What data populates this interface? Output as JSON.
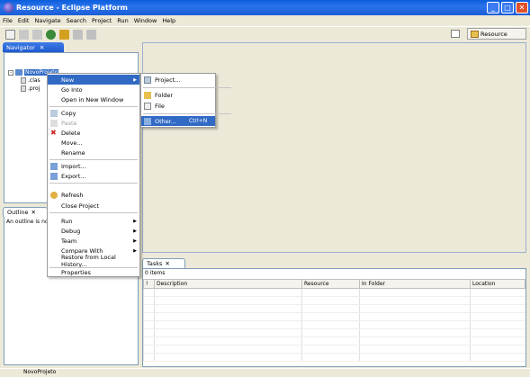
{
  "window": {
    "title": "Resource - Eclipse Platform"
  },
  "menubar": [
    "File",
    "Edit",
    "Navigate",
    "Search",
    "Project",
    "Run",
    "Window",
    "Help"
  ],
  "perspective": {
    "label": "Resource"
  },
  "navigator": {
    "tab_label": "Navigator",
    "items": [
      ".clas",
      ".proj"
    ],
    "project": "NovoProjeto"
  },
  "outline": {
    "tab_label": "Outline",
    "message": "An outline is not"
  },
  "tasks": {
    "tab_label": "Tasks",
    "count": "0 items",
    "columns": [
      "!",
      "Description",
      "Resource",
      "In Folder",
      "Location"
    ]
  },
  "status": {
    "text": "NovoProjeto"
  },
  "context_menu": {
    "items": [
      {
        "label": "New",
        "submenu": true,
        "selected": true
      },
      {
        "label": "Go Into"
      },
      {
        "label": "Open in New Window"
      },
      {
        "label": "Copy"
      },
      {
        "label": "Paste",
        "disabled": true
      },
      {
        "label": "Delete"
      },
      {
        "label": "Move..."
      },
      {
        "label": "Rename"
      },
      {
        "label": "Import..."
      },
      {
        "label": "Export..."
      },
      {
        "label": "Refresh"
      },
      {
        "label": "Close Project"
      },
      {
        "label": "Run",
        "submenu": true
      },
      {
        "label": "Debug",
        "submenu": true
      },
      {
        "label": "Team",
        "submenu": true
      },
      {
        "label": "Compare With",
        "submenu": true
      },
      {
        "label": "Restore from Local History..."
      },
      {
        "label": "Properties"
      }
    ]
  },
  "new_submenu": {
    "items": [
      {
        "label": "Project..."
      },
      {
        "label": "Folder"
      },
      {
        "label": "File"
      },
      {
        "label": "Other...",
        "shortcut": "Ctrl+N",
        "selected": true
      }
    ]
  }
}
